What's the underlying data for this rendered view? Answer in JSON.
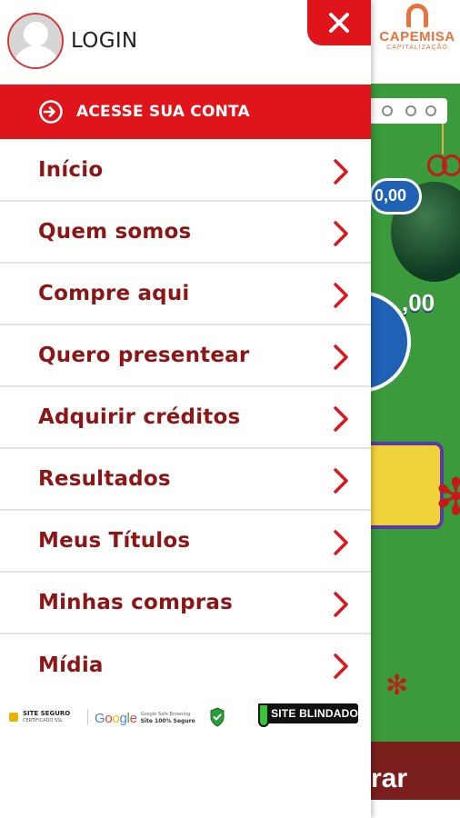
{
  "header": {
    "login_label": "LOGIN",
    "close_symbol": "✕"
  },
  "account_button": {
    "label": "ACESSE SUA CONTA",
    "icon": "login-icon"
  },
  "menu": {
    "items": [
      {
        "label": "Início"
      },
      {
        "label": "Quem somos"
      },
      {
        "label": "Compre aqui"
      },
      {
        "label": "Quero presentear"
      },
      {
        "label": "Adquirir créditos"
      },
      {
        "label": "Resultados"
      },
      {
        "label": "Meus Títulos"
      },
      {
        "label": "Minhas compras"
      },
      {
        "label": "Mídia"
      }
    ]
  },
  "badges": {
    "site_seguro": "SITE SEGURO",
    "site_seguro_sub": "CERTIFICADO SSL",
    "google": "Google",
    "google_line1": "Google Safe Browsing",
    "google_line2": "Site 100% Seguro",
    "site_blindado": "SITE BLINDADO"
  },
  "background": {
    "brand_name": "CAPEMISA",
    "brand_sub": "CAPITALIZAÇÃO",
    "coin_small": "0,00",
    "coin_large": ",00",
    "bottom_button_fragment": "rar"
  },
  "colors": {
    "primary_red": "#e0151b",
    "menu_text": "#8c1616",
    "brand_orange": "#e8733a",
    "bg_green": "#3a9a3c"
  }
}
